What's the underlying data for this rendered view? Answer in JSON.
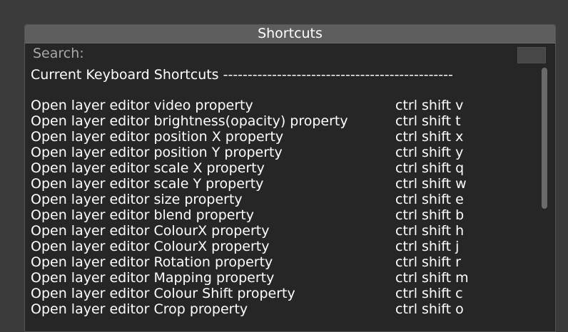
{
  "window": {
    "title": "Shortcuts"
  },
  "search": {
    "label": "Search:",
    "value": ""
  },
  "list": {
    "heading": "Current Keyboard Shortcuts -----------------------------------------------",
    "rows": [
      {
        "action": "Open layer editor video property",
        "keys": "ctrl shift v"
      },
      {
        "action": "Open layer editor brightness(opacity) property",
        "keys": "ctrl shift t"
      },
      {
        "action": "Open layer editor position X property",
        "keys": "ctrl shift x"
      },
      {
        "action": "Open layer editor position Y property",
        "keys": "ctrl shift y"
      },
      {
        "action": "Open layer editor scale X property",
        "keys": "ctrl shift q"
      },
      {
        "action": "Open layer editor scale Y property",
        "keys": "ctrl shift w"
      },
      {
        "action": "Open layer editor size property",
        "keys": "ctrl shift e"
      },
      {
        "action": "Open layer editor blend property",
        "keys": "ctrl shift b"
      },
      {
        "action": "Open layer editor ColourX property",
        "keys": "ctrl shift h"
      },
      {
        "action": "Open layer editor ColourX property",
        "keys": "ctrl shift j"
      },
      {
        "action": "Open layer editor Rotation property",
        "keys": "ctrl shift r"
      },
      {
        "action": "Open layer editor Mapping property",
        "keys": "ctrl shift m"
      },
      {
        "action": "Open layer editor Colour Shift property",
        "keys": "ctrl shift c"
      },
      {
        "action": "Open layer editor Crop property",
        "keys": "ctrl shift o"
      }
    ]
  }
}
